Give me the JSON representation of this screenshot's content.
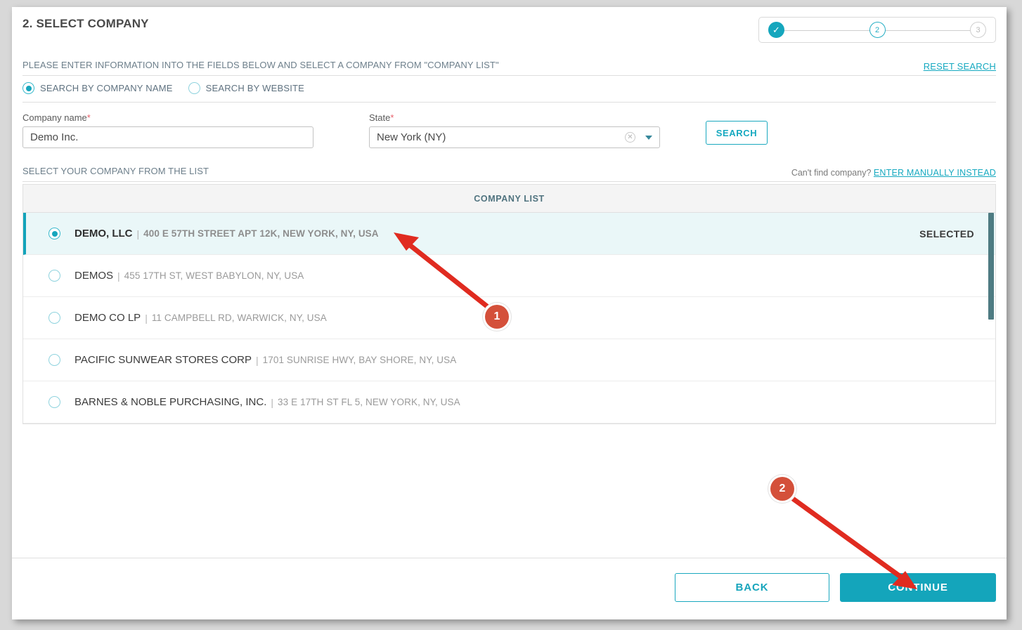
{
  "header": {
    "title": "2. SELECT COMPANY",
    "stepper": {
      "step1": "✓",
      "step2": "2",
      "step3": "3"
    }
  },
  "instructions": {
    "text": "PLEASE ENTER INFORMATION INTO THE FIELDS BELOW AND SELECT A COMPANY FROM \"COMPANY LIST\"",
    "reset_label": "RESET SEARCH"
  },
  "search_mode": {
    "options": [
      {
        "label": "SEARCH BY COMPANY NAME",
        "selected": true
      },
      {
        "label": "SEARCH BY WEBSITE",
        "selected": false
      }
    ]
  },
  "form": {
    "company_name": {
      "label": "Company name",
      "required_mark": "*",
      "value": "Demo Inc.",
      "placeholder": "Company name"
    },
    "state": {
      "label": "State",
      "required_mark": "*",
      "value": "New York (NY)",
      "clear_icon": "close-circle-icon",
      "caret_icon": "chevron-down-icon"
    },
    "search_button": "SEARCH"
  },
  "list_section": {
    "caption": "SELECT YOUR COMPANY FROM THE LIST",
    "cant_find_text": "Can't find company?",
    "manual_link": "ENTER MANUALLY INSTEAD",
    "column_header": "COMPANY LIST",
    "selected_status": "SELECTED",
    "rows": [
      {
        "name": "DEMO, LLC",
        "separator": "|",
        "address": "400 E 57TH STREET APT 12K, NEW YORK, NY, USA",
        "selected": true,
        "status": "SELECTED"
      },
      {
        "name": "DEMOS",
        "separator": "|",
        "address": "455 17TH ST, WEST BABYLON, NY, USA",
        "selected": false,
        "status": ""
      },
      {
        "name": "DEMO CO LP",
        "separator": "|",
        "address": "11 CAMPBELL RD, WARWICK, NY, USA",
        "selected": false,
        "status": ""
      },
      {
        "name": "PACIFIC SUNWEAR STORES CORP",
        "separator": "|",
        "address": "1701 SUNRISE HWY, BAY SHORE, NY, USA",
        "selected": false,
        "status": ""
      },
      {
        "name": "BARNES & NOBLE PURCHASING, INC.",
        "separator": "|",
        "address": "33 E 17TH ST FL 5, NEW YORK, NY, USA",
        "selected": false,
        "status": ""
      }
    ]
  },
  "footer": {
    "back_label": "BACK",
    "continue_label": "CONTINUE"
  },
  "annotations": {
    "badge1": "1",
    "badge2": "2"
  },
  "colors": {
    "accent": "#14a5bb",
    "accent_link": "#16a9c0",
    "selected_row_bg": "#eaf7f8",
    "annotation_red": "#e02b20",
    "badge_bg": "#d4503a",
    "required": "#e8606a"
  }
}
